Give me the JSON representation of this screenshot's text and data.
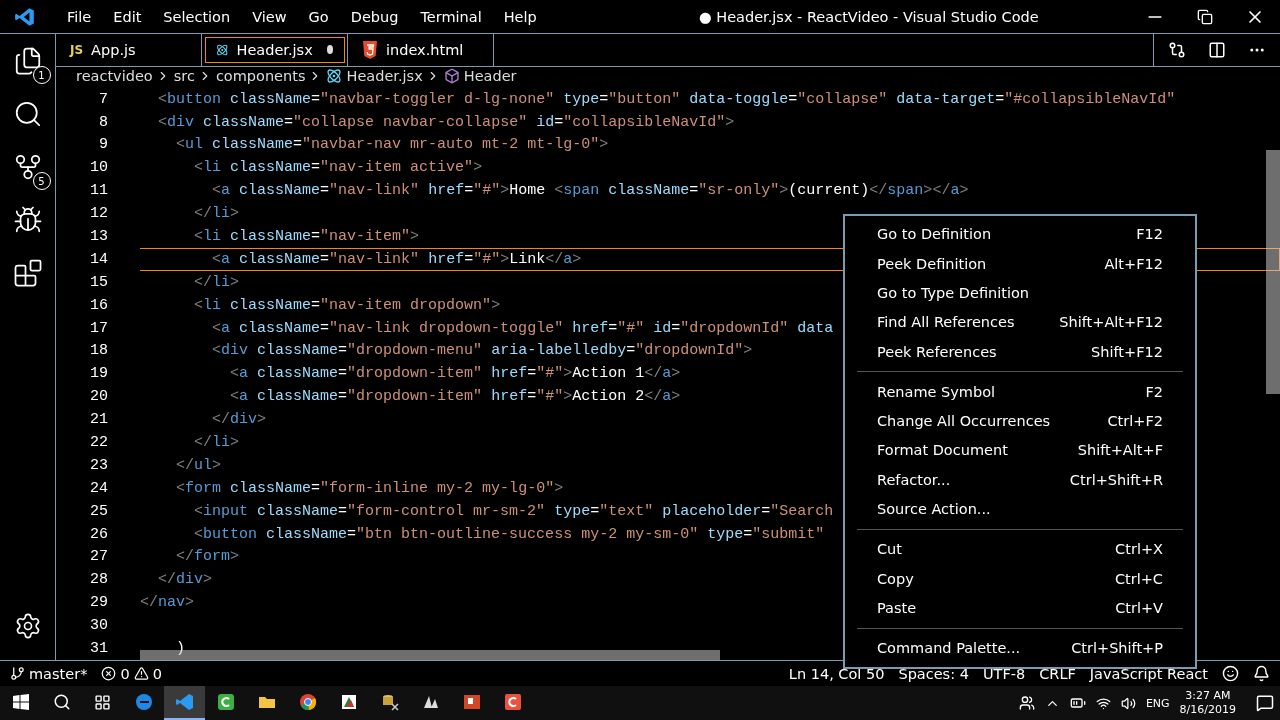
{
  "title_bar": {
    "menus": [
      "File",
      "Edit",
      "Selection",
      "View",
      "Go",
      "Debug",
      "Terminal",
      "Help"
    ],
    "title": "● Header.jsx - ReactVideo - Visual Studio Code"
  },
  "activity_bar": [
    {
      "kind": "explorer",
      "badge": "1"
    },
    {
      "kind": "search"
    },
    {
      "kind": "source-control",
      "badge": "5"
    },
    {
      "kind": "debug"
    },
    {
      "kind": "extensions"
    }
  ],
  "tabs": [
    {
      "label": "App.js",
      "kind": "js",
      "icon_text": "JS",
      "selected": false,
      "dirty": false
    },
    {
      "label": "Header.jsx",
      "kind": "react",
      "selected": true,
      "dirty": true
    },
    {
      "label": "index.html",
      "kind": "html",
      "selected": false,
      "dirty": false
    }
  ],
  "breadcrumbs": [
    {
      "label": "reactvideo"
    },
    {
      "label": "src"
    },
    {
      "label": "components"
    },
    {
      "label": "Header.jsx",
      "kind": "react"
    },
    {
      "label": "Header",
      "kind": "component"
    }
  ],
  "code_lines": [
    {
      "number": "7",
      "text": "  <button className=\"navbar-toggler d-lg-none\" type=\"button\" data-toggle=\"collapse\" data-target=\"#collapsibleNavId\"",
      "current": false
    },
    {
      "number": "8",
      "text": "  <div className=\"collapse navbar-collapse\" id=\"collapsibleNavId\">",
      "current": false
    },
    {
      "number": "9",
      "text": "    <ul className=\"navbar-nav mr-auto mt-2 mt-lg-0\">",
      "current": false
    },
    {
      "number": "10",
      "text": "      <li className=\"nav-item active\">",
      "current": false
    },
    {
      "number": "11",
      "text": "        <a className=\"nav-link\" href=\"#\">Home <span className=\"sr-only\">(current)</span></a>",
      "current": false
    },
    {
      "number": "12",
      "text": "      </li>",
      "current": false
    },
    {
      "number": "13",
      "text": "      <li className=\"nav-item\">",
      "current": false
    },
    {
      "number": "14",
      "text": "        <a className=\"nav-link\" href=\"#\">Link</a>",
      "current": true
    },
    {
      "number": "15",
      "text": "      </li>",
      "current": false
    },
    {
      "number": "16",
      "text": "      <li className=\"nav-item dropdown\">",
      "current": false
    },
    {
      "number": "17",
      "text": "        <a className=\"nav-link dropdown-toggle\" href=\"#\" id=\"dropdownId\" data",
      "current": false
    },
    {
      "number": "18",
      "text": "        <div className=\"dropdown-menu\" aria-labelledby=\"dropdownId\">",
      "current": false
    },
    {
      "number": "19",
      "text": "          <a className=\"dropdown-item\" href=\"#\">Action 1</a>",
      "current": false
    },
    {
      "number": "20",
      "text": "          <a className=\"dropdown-item\" href=\"#\">Action 2</a>",
      "current": false
    },
    {
      "number": "21",
      "text": "        </div>",
      "current": false
    },
    {
      "number": "22",
      "text": "      </li>",
      "current": false
    },
    {
      "number": "23",
      "text": "    </ul>",
      "current": false
    },
    {
      "number": "24",
      "text": "    <form className=\"form-inline my-2 my-lg-0\">",
      "current": false
    },
    {
      "number": "25",
      "text": "      <input className=\"form-control mr-sm-2\" type=\"text\" placeholder=\"Search",
      "current": false
    },
    {
      "number": "26",
      "text": "      <button className=\"btn btn-outline-success my-2 my-sm-0\" type=\"submit\"",
      "current": false
    },
    {
      "number": "27",
      "text": "    </form>",
      "current": false
    },
    {
      "number": "28",
      "text": "  </div>",
      "current": false
    },
    {
      "number": "29",
      "text": "</nav>",
      "current": false
    },
    {
      "number": "30",
      "current": false
    },
    {
      "number": "31",
      "text": "    )",
      "current": false
    }
  ],
  "context_menu": [
    [
      {
        "label": "Go to Definition",
        "shortcut": "F12"
      },
      {
        "label": "Peek Definition",
        "shortcut": "Alt+F12"
      },
      {
        "label": "Go to Type Definition"
      },
      {
        "label": "Find All References",
        "shortcut": "Shift+Alt+F12"
      },
      {
        "label": "Peek References",
        "shortcut": "Shift+F12"
      }
    ],
    [
      {
        "label": "Rename Symbol",
        "shortcut": "F2"
      },
      {
        "label": "Change All Occurrences",
        "shortcut": "Ctrl+F2"
      },
      {
        "label": "Format Document",
        "shortcut": "Shift+Alt+F"
      },
      {
        "label": "Refactor...",
        "shortcut": "Ctrl+Shift+R"
      },
      {
        "label": "Source Action..."
      }
    ],
    [
      {
        "label": "Cut",
        "shortcut": "Ctrl+X"
      },
      {
        "label": "Copy",
        "shortcut": "Ctrl+C"
      },
      {
        "label": "Paste",
        "shortcut": "Ctrl+V"
      }
    ],
    [
      {
        "label": "Command Palette...",
        "shortcut": "Ctrl+Shift+P"
      }
    ]
  ],
  "status_bar": {
    "branch": "master*",
    "errors": "0",
    "warnings": "0",
    "items": [
      "Ln 14, Col 50",
      "Spaces: 4",
      "UTF-8",
      "CRLF",
      "JavaScript React"
    ]
  },
  "taskbar": {
    "apps": [
      {
        "kind": "edge",
        "active": false
      },
      {
        "kind": "vscode",
        "active": true
      },
      {
        "kind": "camtasia",
        "active": false
      },
      {
        "kind": "folder",
        "active": false
      },
      {
        "kind": "chrome",
        "active": false
      },
      {
        "kind": "other",
        "active": false
      },
      {
        "kind": "tool",
        "active": false
      },
      {
        "kind": "game",
        "active": false
      },
      {
        "kind": "powerpoint",
        "active": false
      },
      {
        "kind": "recorder",
        "active": false
      }
    ],
    "language": "ENG",
    "time": "3:27 AM",
    "date": "8/16/2019"
  }
}
